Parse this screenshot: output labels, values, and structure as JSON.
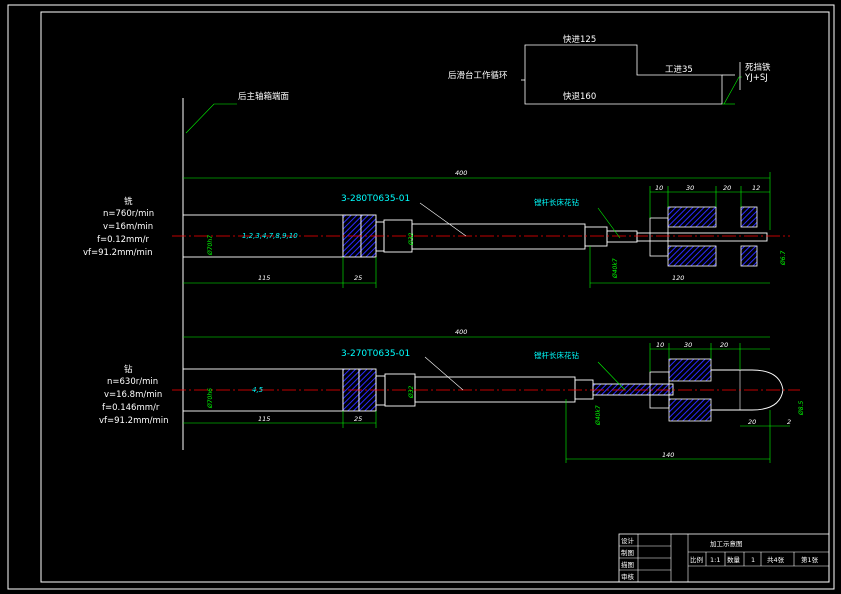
{
  "colors": {
    "background": "#000000",
    "outline": "#ffffff",
    "dimension": "#00ff00",
    "centerline": "#ff0000",
    "hatch": "#1a1aff",
    "label": "#00ffff"
  },
  "cycle": {
    "title": "后滑台工作循环",
    "rapid_forward": "快进125",
    "work_feed": "工进35",
    "dwell": "死挡铁",
    "dwell_note": "YJ+SJ",
    "rapid_return": "快退160"
  },
  "header_note": "后主轴箱端面",
  "row1": {
    "operation": "铣",
    "params": [
      "n=760r/min",
      "v=16m/min",
      "f=0.12mm/r",
      "vf=91.2mm/min"
    ],
    "part_code": "3-280T0635-01",
    "drill_label": "镗杆长床花钻",
    "spindle_numbers": "1,2,3,4,7,8,9,10",
    "dims": {
      "overall": "400",
      "seg1": "115",
      "seg2": "25",
      "seg3": "120",
      "d1": "10",
      "d2": "30",
      "d3": "20",
      "d4": "12",
      "dia_body": "Ø70h7",
      "dia_mid": "Ø32",
      "dia_small": "Ø40k7",
      "dia_end": "Ø6.7"
    }
  },
  "row2": {
    "operation": "钻",
    "params": [
      "n=630r/min",
      "v=16.8m/min",
      "f=0.146mm/r",
      "vf=91.2mm/min"
    ],
    "part_code": "3-270T0635-01",
    "drill_label": "镗杆长床花钻",
    "spindle_numbers": "4,5",
    "dims": {
      "overall": "400",
      "seg1": "115",
      "seg2": "25",
      "seg3": "140",
      "d1": "10",
      "d2": "30",
      "d3": "20",
      "d4": "20",
      "d5": "2",
      "dia_body": "Ø70h6",
      "dia_mid": "Ø32",
      "dia_small": "Ø40k7",
      "dia_end": "Ø8.5"
    }
  },
  "title_block": {
    "drawing_title": "加工示意图",
    "left_labels": [
      "设计",
      "制图",
      "描图",
      "审核"
    ],
    "scale_label": "比例",
    "scale_value": "1:1",
    "qty_label": "数量",
    "qty_value": "1",
    "sheets_total": "共4张",
    "sheet_no": "第1张"
  }
}
